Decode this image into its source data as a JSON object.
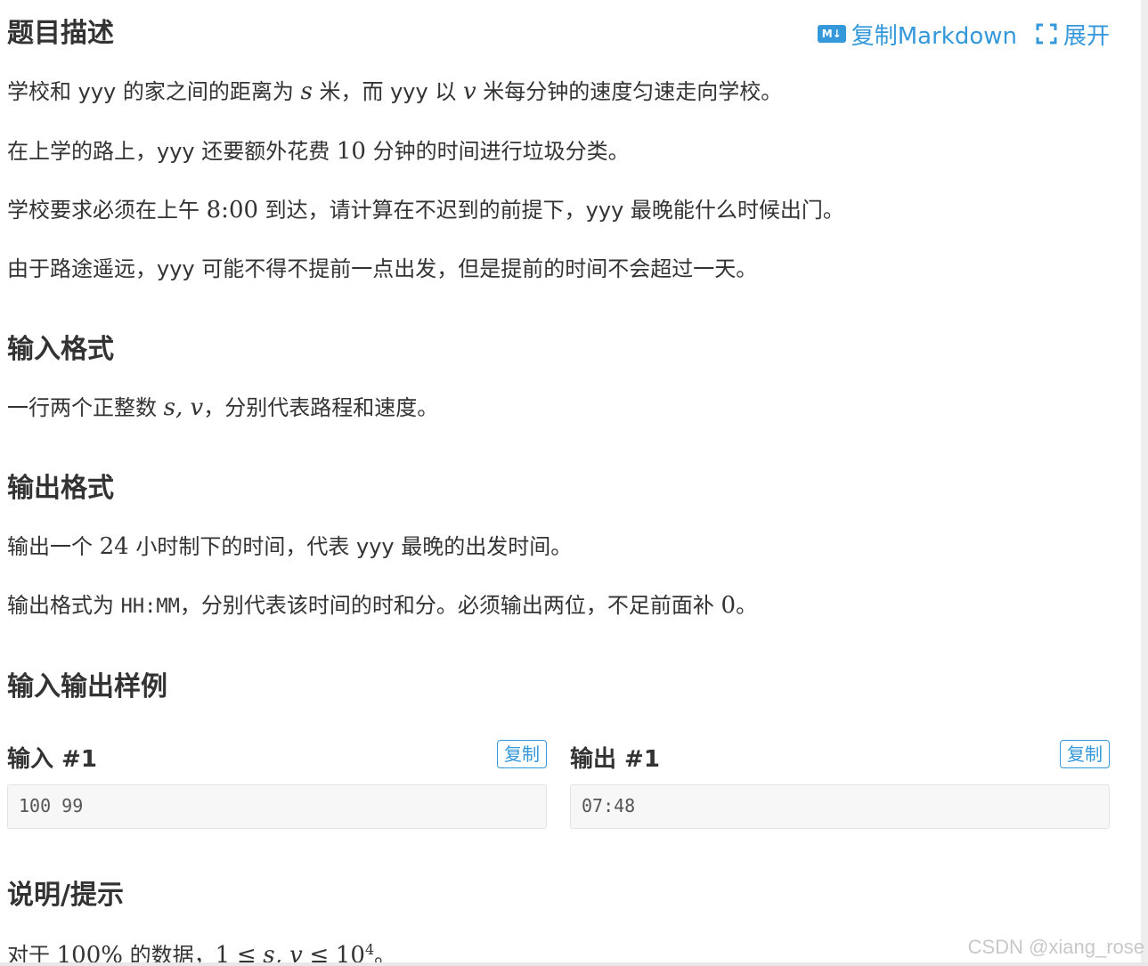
{
  "header": {
    "title": "题目描述",
    "copy_markdown_icon": "M↓",
    "copy_markdown_label": "复制Markdown",
    "expand_label": "展开"
  },
  "description": {
    "p1": {
      "a": "学校和 yyy 的家之间的距离为 ",
      "s": "s",
      "b": " 米，而 yyy 以 ",
      "v": "v",
      "c": " 米每分钟的速度匀速走向学校。"
    },
    "p2": {
      "a": "在上学的路上，yyy 还要额外花费 ",
      "n": "10",
      "b": " 分钟的时间进行垃圾分类。"
    },
    "p3": {
      "a": "学校要求必须在上午 ",
      "t": "8:00",
      "b": " 到达，请计算在不迟到的前提下，yyy 最晚能什么时候出门。"
    },
    "p4": "由于路途遥远，yyy 可能不得不提前一点出发，但是提前的时间不会超过一天。"
  },
  "input_format": {
    "title": "输入格式",
    "p1": {
      "a": "一行两个正整数 ",
      "sv": "s, v",
      "b": "，分别代表路程和速度。"
    }
  },
  "output_format": {
    "title": "输出格式",
    "p1": {
      "a": "输出一个 ",
      "n": "24",
      "b": " 小时制下的时间，代表 yyy 最晚的出发时间。"
    },
    "p2": {
      "a": "输出格式为 ",
      "code": "HH:MM",
      "b": "，分别代表该时间的时和分。必须输出两位，不足前面补 ",
      "zero": "0",
      "c": "。"
    }
  },
  "samples": {
    "title": "输入输出样例",
    "input_label": "输入 #1",
    "output_label": "输出 #1",
    "copy_label": "复制",
    "input_value": "100 99",
    "output_value": "07:48"
  },
  "hint": {
    "title": "说明/提示",
    "a": "对于 ",
    "pct": "100%",
    "b": " 的数据，",
    "range_lo": "1",
    "lt1": "≤",
    "vars": "s, v",
    "lt2": "≤",
    "base": "10",
    "exp": "4",
    "c": "。"
  },
  "watermark": "CSDN @xiang_rose",
  "colors": {
    "accent": "#3498db",
    "text": "#333333",
    "sample_bg": "#f7f7f7"
  }
}
